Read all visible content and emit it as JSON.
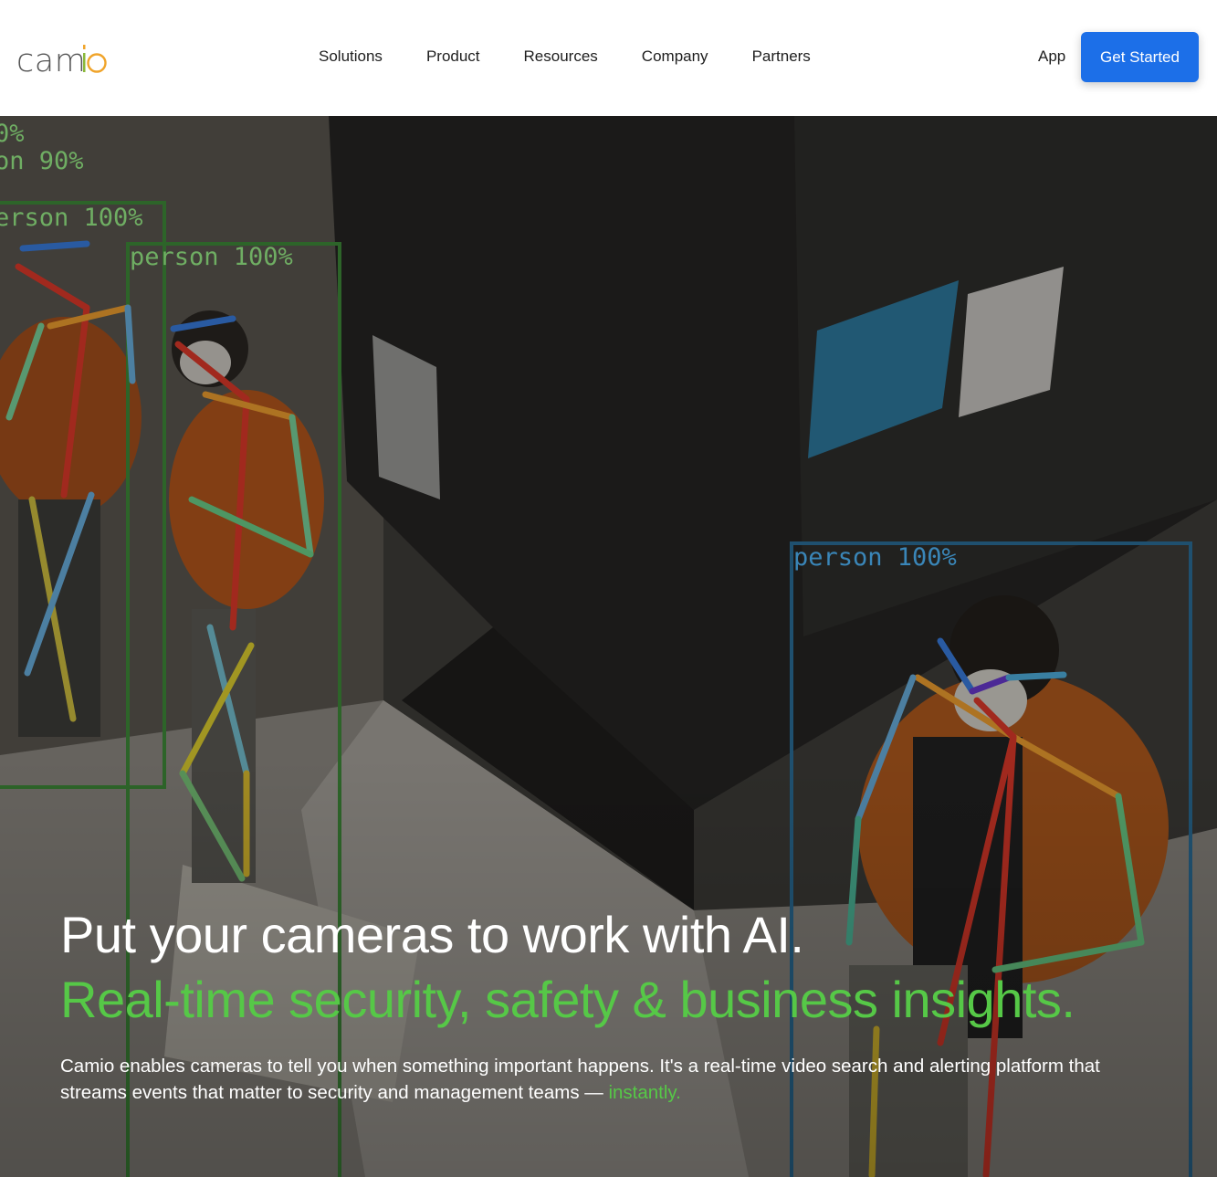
{
  "header": {
    "logo": {
      "text": "camio"
    },
    "nav": [
      {
        "label": "Solutions"
      },
      {
        "label": "Product"
      },
      {
        "label": "Resources"
      },
      {
        "label": "Company"
      },
      {
        "label": "Partners"
      }
    ],
    "app_label": "App",
    "cta_label": "Get Started"
  },
  "hero": {
    "headline": "Put your cameras to work with AI.",
    "subheadline": "Real-time security, safety & business insights.",
    "description": "Camio enables cameras to tell you when something important happens. It's a real-time video search and alerting platform that streams events that matter to security and management teams — ",
    "description_accent": "instantly.",
    "detections": [
      {
        "label": "0%"
      },
      {
        "label": "on 90%"
      },
      {
        "label": "erson 100%"
      },
      {
        "label": "person 100%"
      },
      {
        "label": "person 100%"
      }
    ]
  },
  "colors": {
    "brand_blue": "#1c6fe8",
    "accent_green": "#56c847"
  }
}
